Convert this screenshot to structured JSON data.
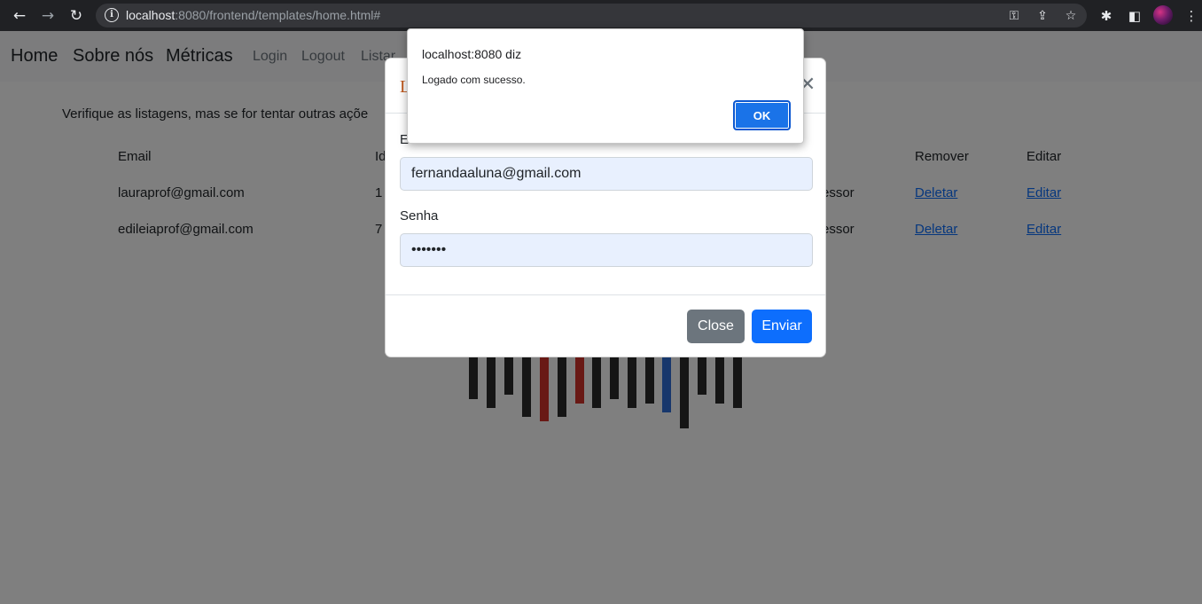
{
  "browser": {
    "url_host": "localhost",
    "url_rest": ":8080/frontend/templates/home.html#",
    "icons": [
      "back-arrow-icon",
      "forward-arrow-icon",
      "reload-icon",
      "info-icon",
      "key-icon",
      "share-icon",
      "star-icon",
      "extensions-icon",
      "sidebar-icon",
      "more-icon"
    ]
  },
  "navbar": {
    "home": "Home",
    "about": "Sobre nós",
    "metrics": "Métricas",
    "login": "Login",
    "logout": "Logout",
    "list": "Listar"
  },
  "main": {
    "intro": "Verifique as listagens, mas se for tentar outras açõe",
    "table": {
      "headers": [
        "Email",
        "Id",
        "Remover",
        "Editar"
      ],
      "rows": [
        {
          "email": "lauraprof@gmail.com",
          "id": "1",
          "role": "essor",
          "remove": "Deletar",
          "edit": "Editar"
        },
        {
          "email": "edileiaprof@gmail.com",
          "id": "7",
          "role": "essor",
          "remove": "Deletar",
          "edit": "Editar"
        }
      ]
    }
  },
  "modal": {
    "title": "L",
    "email_label": "E",
    "email_value": "fernandaaluna@gmail.com",
    "password_label": "Senha",
    "password_value": "•••••••",
    "close_label": "Close",
    "submit_label": "Enviar"
  },
  "alert": {
    "title": "localhost:8080 diz",
    "message": "Logado com sucesso.",
    "ok_label": "OK"
  },
  "colors": {
    "accent": "#0d6efd",
    "alert_ok": "#1a73e8",
    "modal_title": "#c0571b",
    "logo_red": "#d3322b",
    "logo_blue": "#2f6fd8"
  }
}
